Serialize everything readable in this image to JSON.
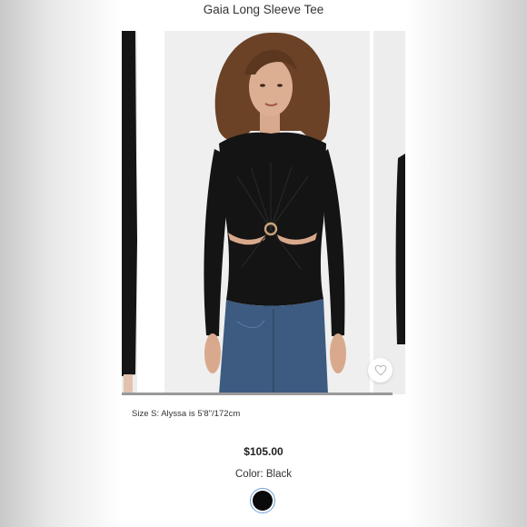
{
  "product": {
    "title": "Gaia Long Sleeve Tee",
    "size_note": "Size S: Alyssa is 5'8\"/172cm",
    "price": "$105.00",
    "color_label": "Color: Black",
    "swatch_color": "#0a0a0a"
  },
  "carousel": {
    "progress": 1.0,
    "favorite_icon": "heart-outline-icon"
  },
  "colors": {
    "garment": "#141414",
    "skin": "#d9a98d",
    "hair": "#6b4226",
    "denim": "#3d5a80"
  }
}
